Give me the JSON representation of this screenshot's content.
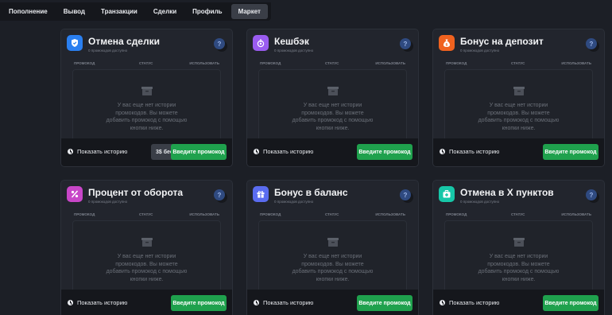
{
  "nav": {
    "tabs": [
      "Пополнение",
      "Вывод",
      "Транзакции",
      "Сделки",
      "Профиль",
      "Маркет"
    ],
    "active": "Маркет"
  },
  "common": {
    "subtitle": "0 промокодов доступно",
    "col_promo": "ПРОМОКОД",
    "col_status": "СТАТУС",
    "col_use": "ИСПОЛЬЗОВАТЬ",
    "empty_text": "У вас еще нет истории промокодов. Вы можете добавить промокод с помощью кнопки ниже.",
    "history_label": "Показать историю",
    "enter_label": "Введите промокод",
    "help_label": "?"
  },
  "cards": [
    {
      "title": "Отмена сделки",
      "icon": "shield-icon",
      "icon_color": "#2a7ff0",
      "badge": "3$ бесплатно"
    },
    {
      "title": "Кешбэк",
      "icon": "cashback-icon",
      "icon_color": "#9a5cf0"
    },
    {
      "title": "Бонус на депозит",
      "icon": "money-bag-icon",
      "icon_color": "#f0621f"
    },
    {
      "title": "Процент от оборота",
      "icon": "percent-icon",
      "icon_color": "#c846c8"
    },
    {
      "title": "Бонус в баланс",
      "icon": "gift-icon",
      "icon_color": "#5a6cf0"
    },
    {
      "title": "Отмена в X пунктов",
      "icon": "medkit-icon",
      "icon_color": "#17c7a8"
    }
  ]
}
